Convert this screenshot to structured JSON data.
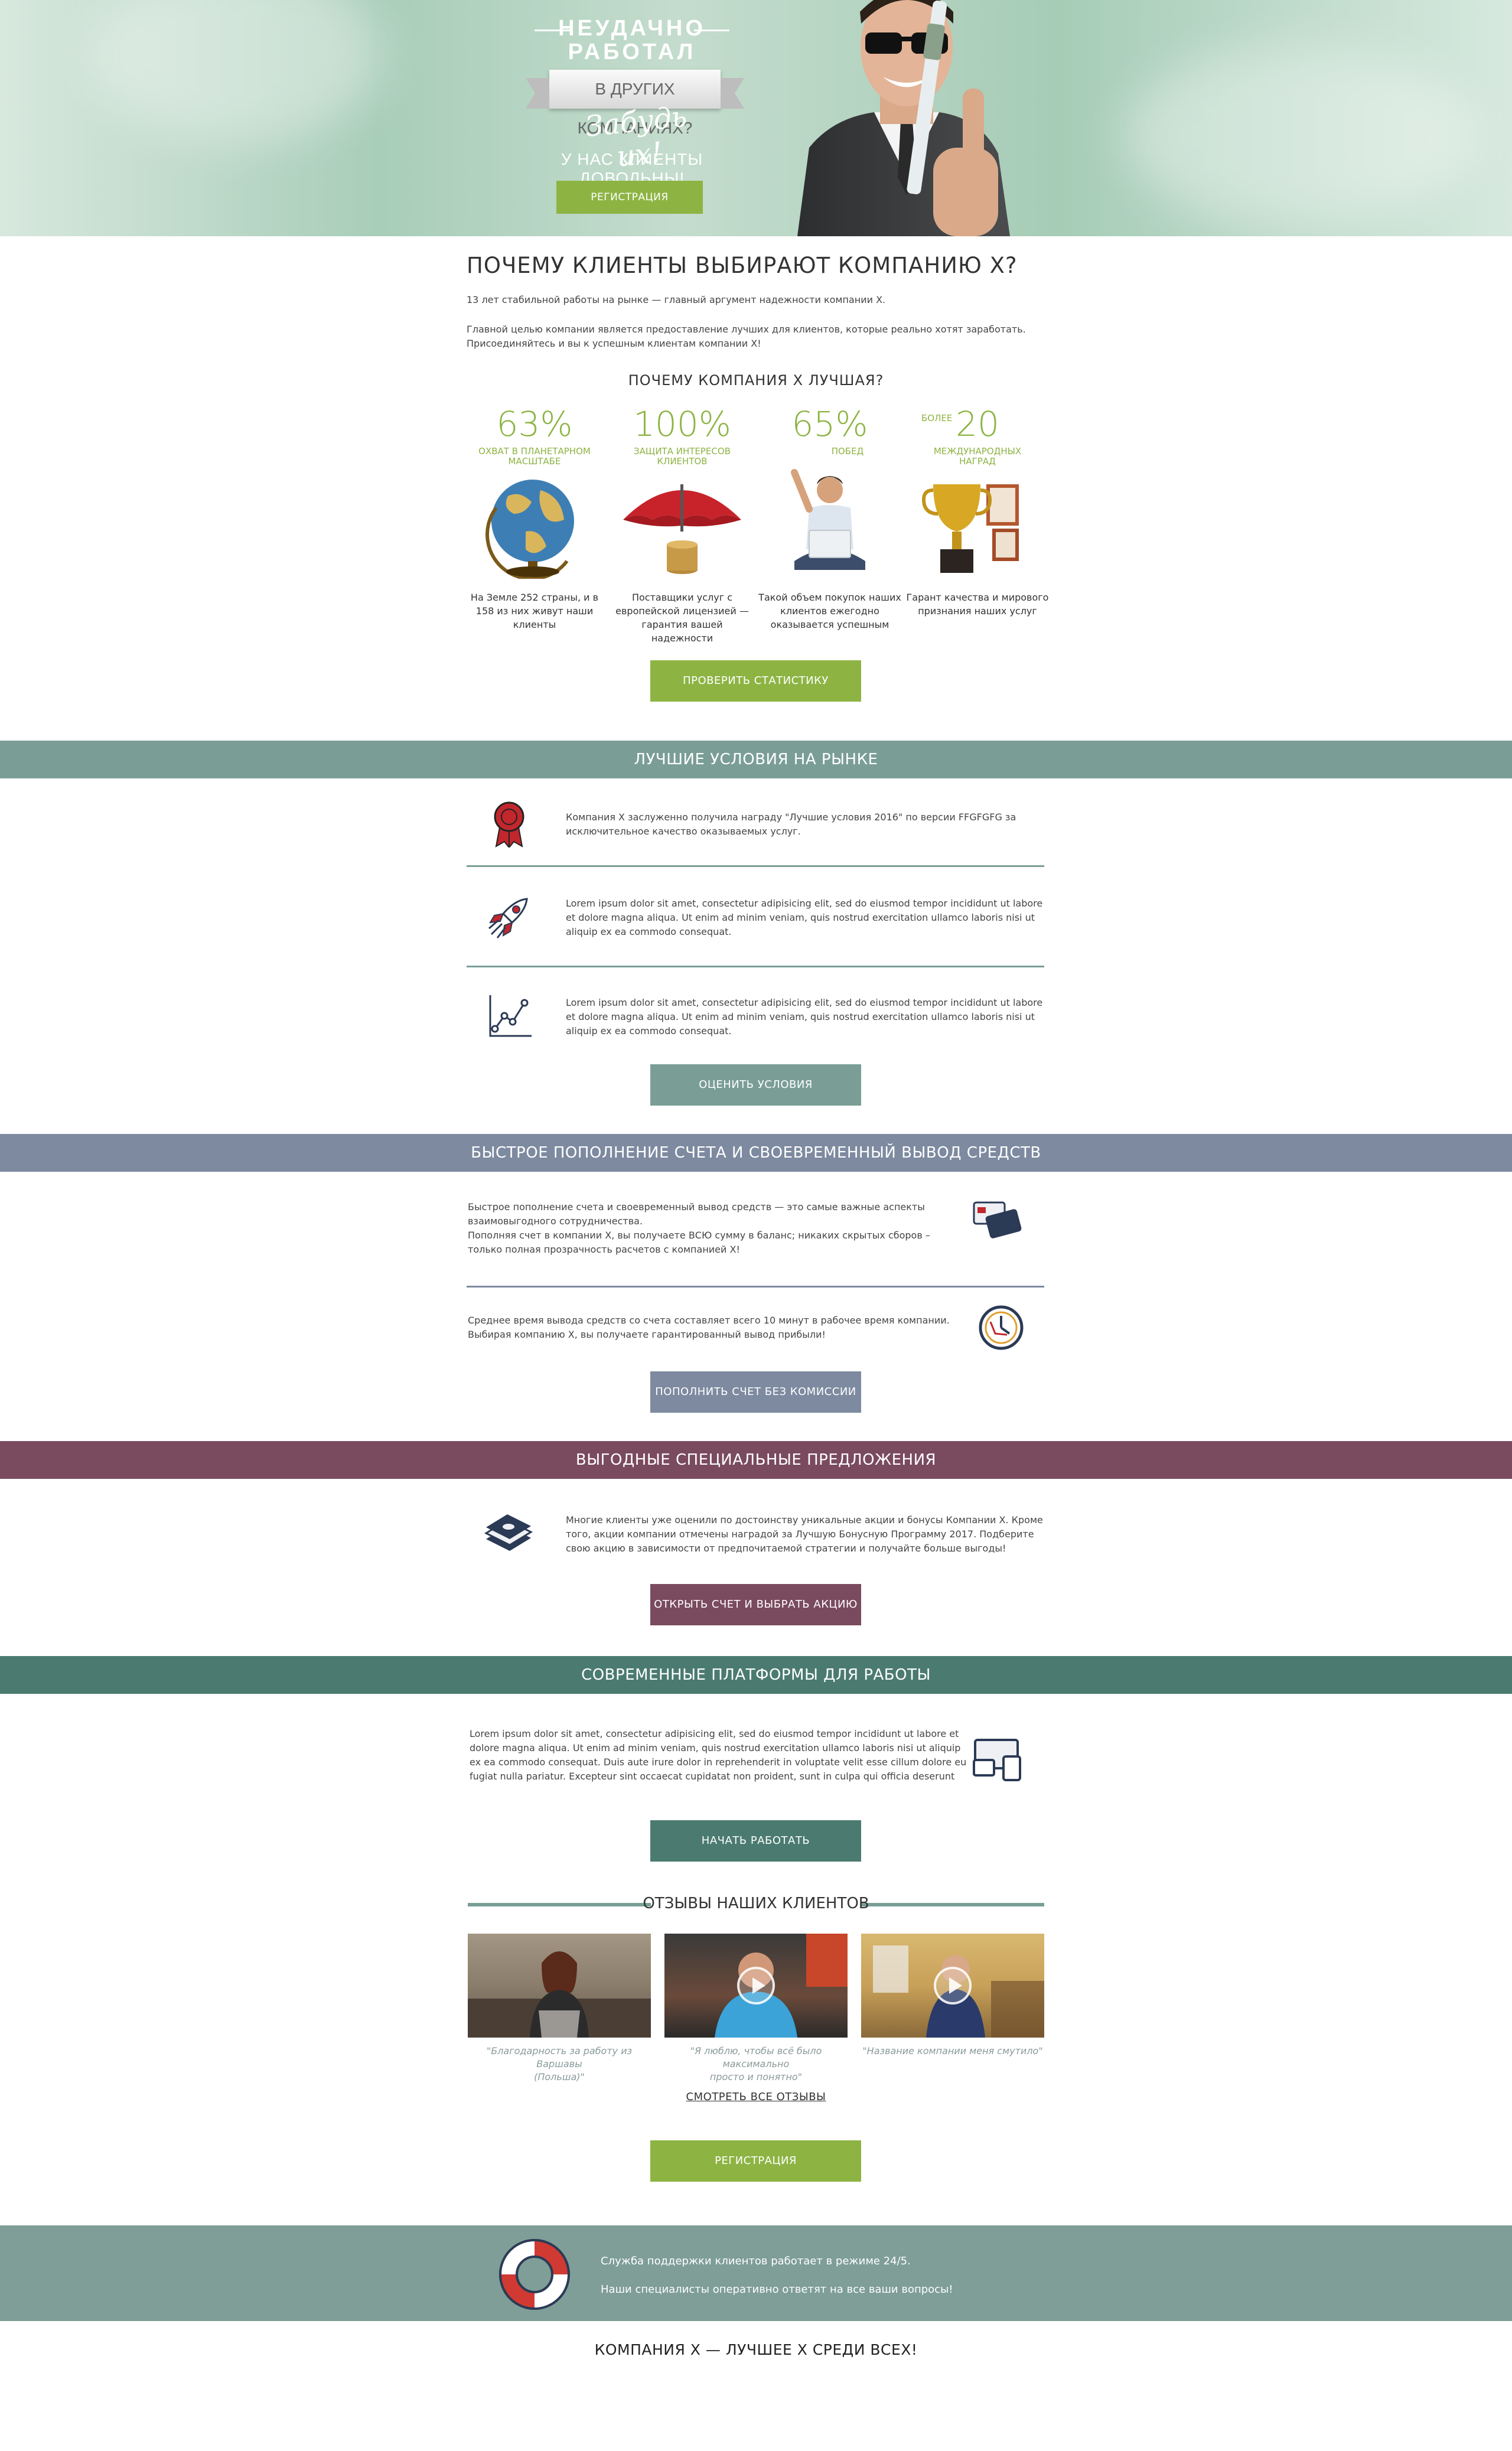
{
  "hero": {
    "title_line1": "НЕУДАЧНО",
    "title_line2": "РАБОТАЛ",
    "ribbon": "В ДРУГИХ КОМПАНИЯХ?",
    "script": "Забудь их!",
    "subtitle": "У НАС КЛИЕНТЫ ДОВОЛЬНЫ!",
    "button": "РЕГИСТРАЦИЯ"
  },
  "why": {
    "title": "ПОЧЕМУ КЛИЕНТЫ ВЫБИРАЮТ КОМПАНИЮ Х?",
    "p1": "13 лет стабильной работы на рынке  — главный аргумент надежности компании Х.",
    "p2_line1": "Главной целью компании является предоставление лучших  для клиентов, которые реально хотят заработать.",
    "p2_line2": "Присоединяйтесь и вы к успешным клиентам компании Х!",
    "subtitle": "ПОЧЕМУ КОМПАНИЯ Х ЛУЧШАЯ?",
    "stats": [
      {
        "prefix": "",
        "num": "63%",
        "label1": "ОХВАТ В ПЛАНЕТАРНОМ",
        "label2": "МАСШТАБЕ",
        "desc1": "На Земле 252 страны, и в",
        "desc2": "158 из них живут наши",
        "desc3": "клиенты",
        "icon": "globe-icon"
      },
      {
        "prefix": "",
        "num": "100%",
        "label1": "ЗАЩИТА ИНТЕРЕСОВ",
        "label2": "КЛИЕНТОВ",
        "desc1": "Поставщики услуг с",
        "desc2": "европейской лицензией —",
        "desc3": "гарантия вашей надежности",
        "icon": "umbrella-icon"
      },
      {
        "prefix": "",
        "num": "65%",
        "label1": "ПОБЕД",
        "label2": "",
        "desc1": "Такой объем покупок наших",
        "desc2": "клиентов ежегодно",
        "desc3": "оказывается успешным",
        "icon": "man-laptop-icon"
      },
      {
        "prefix": "БОЛЕЕ",
        "num": "20",
        "label1": "МЕЖДУНАРОДНЫХ",
        "label2": "НАГРАД",
        "desc1": "Гарант качества и мирового",
        "desc2": "признания наших услуг",
        "desc3": "",
        "icon": "trophy-icon"
      }
    ],
    "button": "ПРОВЕРИТЬ СТАТИСТИКУ"
  },
  "conditions": {
    "band": "ЛУЧШИЕ УСЛОВИЯ НА РЫНКЕ",
    "rows": [
      {
        "icon": "award-icon",
        "l1": "Компания Х заслуженно получила награду \"Лучшие  условия 2016\" по версии FFGFGFG за",
        "l2": "исключительное качество оказываемых услуг.",
        "l3": ""
      },
      {
        "icon": "rocket-icon",
        "l1": "Lorem ipsum dolor sit amet, consectetur adipisicing elit, sed do eiusmod tempor incididunt ut labore",
        "l2": "et dolore magna aliqua. Ut enim ad minim veniam, quis nostrud exercitation ullamco laboris nisi ut",
        "l3": "aliquip ex ea commodo consequat."
      },
      {
        "icon": "growth-chart-icon",
        "l1": "Lorem ipsum dolor sit amet, consectetur adipisicing elit, sed do eiusmod tempor incididunt ut labore",
        "l2": "et dolore magna aliqua. Ut enim ad minim veniam, quis nostrud exercitation ullamco laboris nisi ut",
        "l3": "aliquip ex ea commodo consequat."
      }
    ],
    "button": "ОЦЕНИТЬ УСЛОВИЯ"
  },
  "deposit": {
    "band": "БЫСТРОЕ ПОПОЛНЕНИЕ СЧЕТА И СВОЕВРЕМЕННЫЙ ВЫВОД СРЕДСТВ",
    "row1": {
      "l1": "Быстрое пополнение счета и своевременный вывод средств — это самые важные аспекты",
      "l2": "взаимовыгодного сотрудничества.",
      "l3": "Пополняя счет в компании Х, вы получаете ВСЮ сумму в баланс; никаких скрытых сборов –",
      "l4": "только полная прозрачность расчетов с компанией Х!"
    },
    "row2": {
      "l1": "Среднее время вывода средств со счета составляет всего 10 минут в рабочее время компании.",
      "l2": "Выбирая компанию Х, вы получаете гарантированный вывод прибыли!"
    },
    "button": "ПОПОЛНИТЬ СЧЕТ БЕЗ КОМИССИИ"
  },
  "offers": {
    "band": "ВЫГОДНЫЕ СПЕЦИАЛЬНЫЕ ПРЕДЛОЖЕНИЯ",
    "l1": "Многие клиенты уже оценили по достоинству уникальные акции и бонусы Компании Х. Кроме",
    "l2": "того, акции компании отмечены наградой за Лучшую Бонусную Программу 2017. Подберите",
    "l3": "свою акцию в зависимости от предпочитаемой стратегии и получайте больше выгоды!",
    "button": "ОТКРЫТЬ СЧЕТ И ВЫБРАТЬ АКЦИЮ"
  },
  "platforms": {
    "band": "СОВРЕМЕННЫЕ ПЛАТФОРМЫ ДЛЯ РАБОТЫ",
    "l1": "Lorem ipsum dolor sit amet, consectetur adipisicing elit, sed do eiusmod tempor incididunt ut labore et",
    "l2": "dolore magna aliqua. Ut enim ad minim veniam, quis nostrud exercitation ullamco laboris nisi ut aliquip",
    "l3": "ex ea commodo consequat. Duis aute irure dolor in reprehenderit in voluptate velit esse cillum dolore eu",
    "l4": "fugiat nulla pariatur. Excepteur sint occaecat cupidatat non proident, sunt in culpa qui officia deserunt",
    "button": "НАЧАТЬ РАБОТАТЬ"
  },
  "reviews": {
    "title": "ОТЗЫВЫ НАШИХ КЛИЕНТОВ",
    "items": [
      {
        "q1": "\"Благодарность за работу из Варшавы",
        "q2": "(Польша)\""
      },
      {
        "q1": "\"Я люблю, чтобы всё было максимально",
        "q2": "просто и понятно\""
      },
      {
        "q1": "\"Название компании меня смутило\"",
        "q2": ""
      }
    ],
    "all_link": "СМОТРЕТЬ ВСЕ ОТЗЫВЫ",
    "button": "РЕГИСТРАЦИЯ"
  },
  "support": {
    "l1": "Служба поддержки клиентов работает в режиме 24/5.",
    "l2": "Наши специалисты оперативно ответят на все ваши вопросы!"
  },
  "footer": "КОМПАНИЯ Х — ЛУЧШЕЕ Х СРЕДИ ВСЕХ!",
  "colors": {
    "green": "#8db443",
    "teal": "#7a9e96",
    "slate": "#7d8aa0",
    "plum": "#7a4a5e",
    "darkteal": "#4b7b70"
  }
}
